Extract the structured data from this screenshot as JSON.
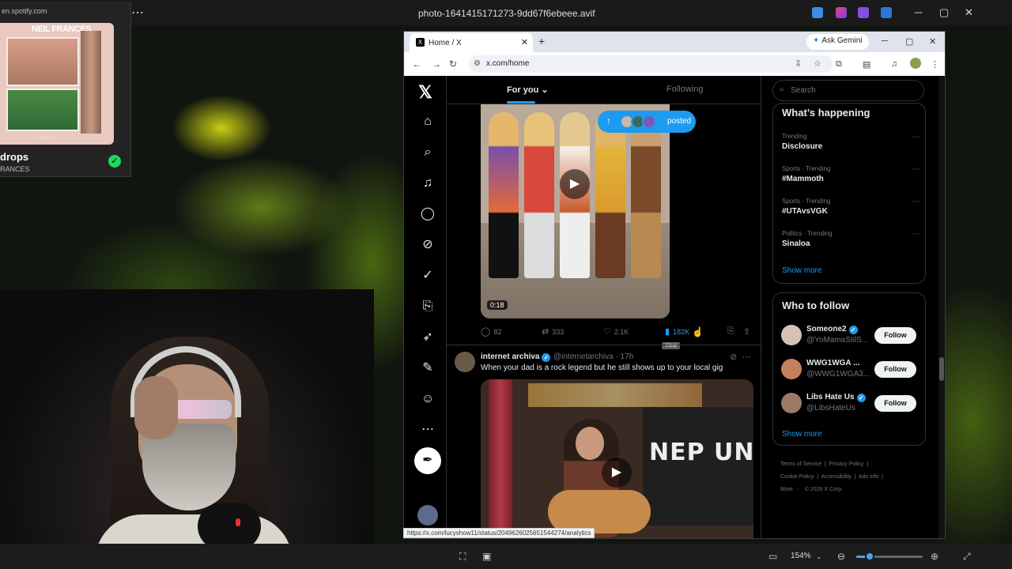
{
  "viewer": {
    "file_name": "photo-1641415171273-9dd67f6ebeee.avif",
    "more_label": "⋯",
    "zoom_label": "154%",
    "zoom_fraction": 0.2
  },
  "spotify": {
    "url": "en.spotify.com",
    "album_artist": "NEIL FRANCES",
    "album_caption": "drops",
    "song_title": "drops",
    "song_artist": "RANCES",
    "saved_icon": "check-circle-icon"
  },
  "browser": {
    "tab_title": "Home / X",
    "tab_close": "✕",
    "new_tab": "+",
    "gemini_label": "Ask Gemini",
    "url": "x.com/home",
    "status_url": "https://x.com/lucyshow11/status/2049626025651544274/analytics"
  },
  "x": {
    "tabs": {
      "for_you": "For you ⌄",
      "following": "Following"
    },
    "post1": {
      "posted_label": "posted",
      "duration": "0:18",
      "replies": "82",
      "reposts": "333",
      "likes": "2.1K",
      "views": "182K",
      "views_tooltip": "View"
    },
    "post2": {
      "name": "internet archiva",
      "handle": "@internetarchiva · 17h",
      "text": "When your dad is a rock legend but he still shows up to your local gig",
      "banner_text": "NEP UN"
    },
    "search_placeholder": "Search",
    "whats_happening": {
      "title": "What’s happening",
      "trends": [
        {
          "meta": "Trending",
          "name": "Disclosure"
        },
        {
          "meta": "Sports · Trending",
          "name": "#Mammoth"
        },
        {
          "meta": "Sports · Trending",
          "name": "#UTAvsVGK"
        },
        {
          "meta": "Politics · Trending",
          "name": "Sinaloa"
        }
      ],
      "show_more": "Show more"
    },
    "who_to_follow": {
      "title": "Who to follow",
      "accounts": [
        {
          "name": "Someone2",
          "handle": "@YoMamaStilS...",
          "button": "Follow"
        },
        {
          "name": "WWG1WGA ...",
          "handle": "@WWG1WGA3...",
          "button": "Follow"
        },
        {
          "name": "Libs Hate Us",
          "handle": "@LibsHateUs",
          "button": "Follow"
        }
      ],
      "show_more": "Show more"
    },
    "footer": {
      "terms": "Terms of Service",
      "privacy": "Privacy Policy",
      "cookie": "Cookie Policy",
      "accessibility": "Accessibility",
      "ads": "Ads info",
      "more": "More ···",
      "copyright": "© 2026 X Corp."
    }
  },
  "colors": {
    "accent": "#1d9bf0",
    "spotify_green": "#1ed760",
    "x_border": "#2f3336"
  }
}
